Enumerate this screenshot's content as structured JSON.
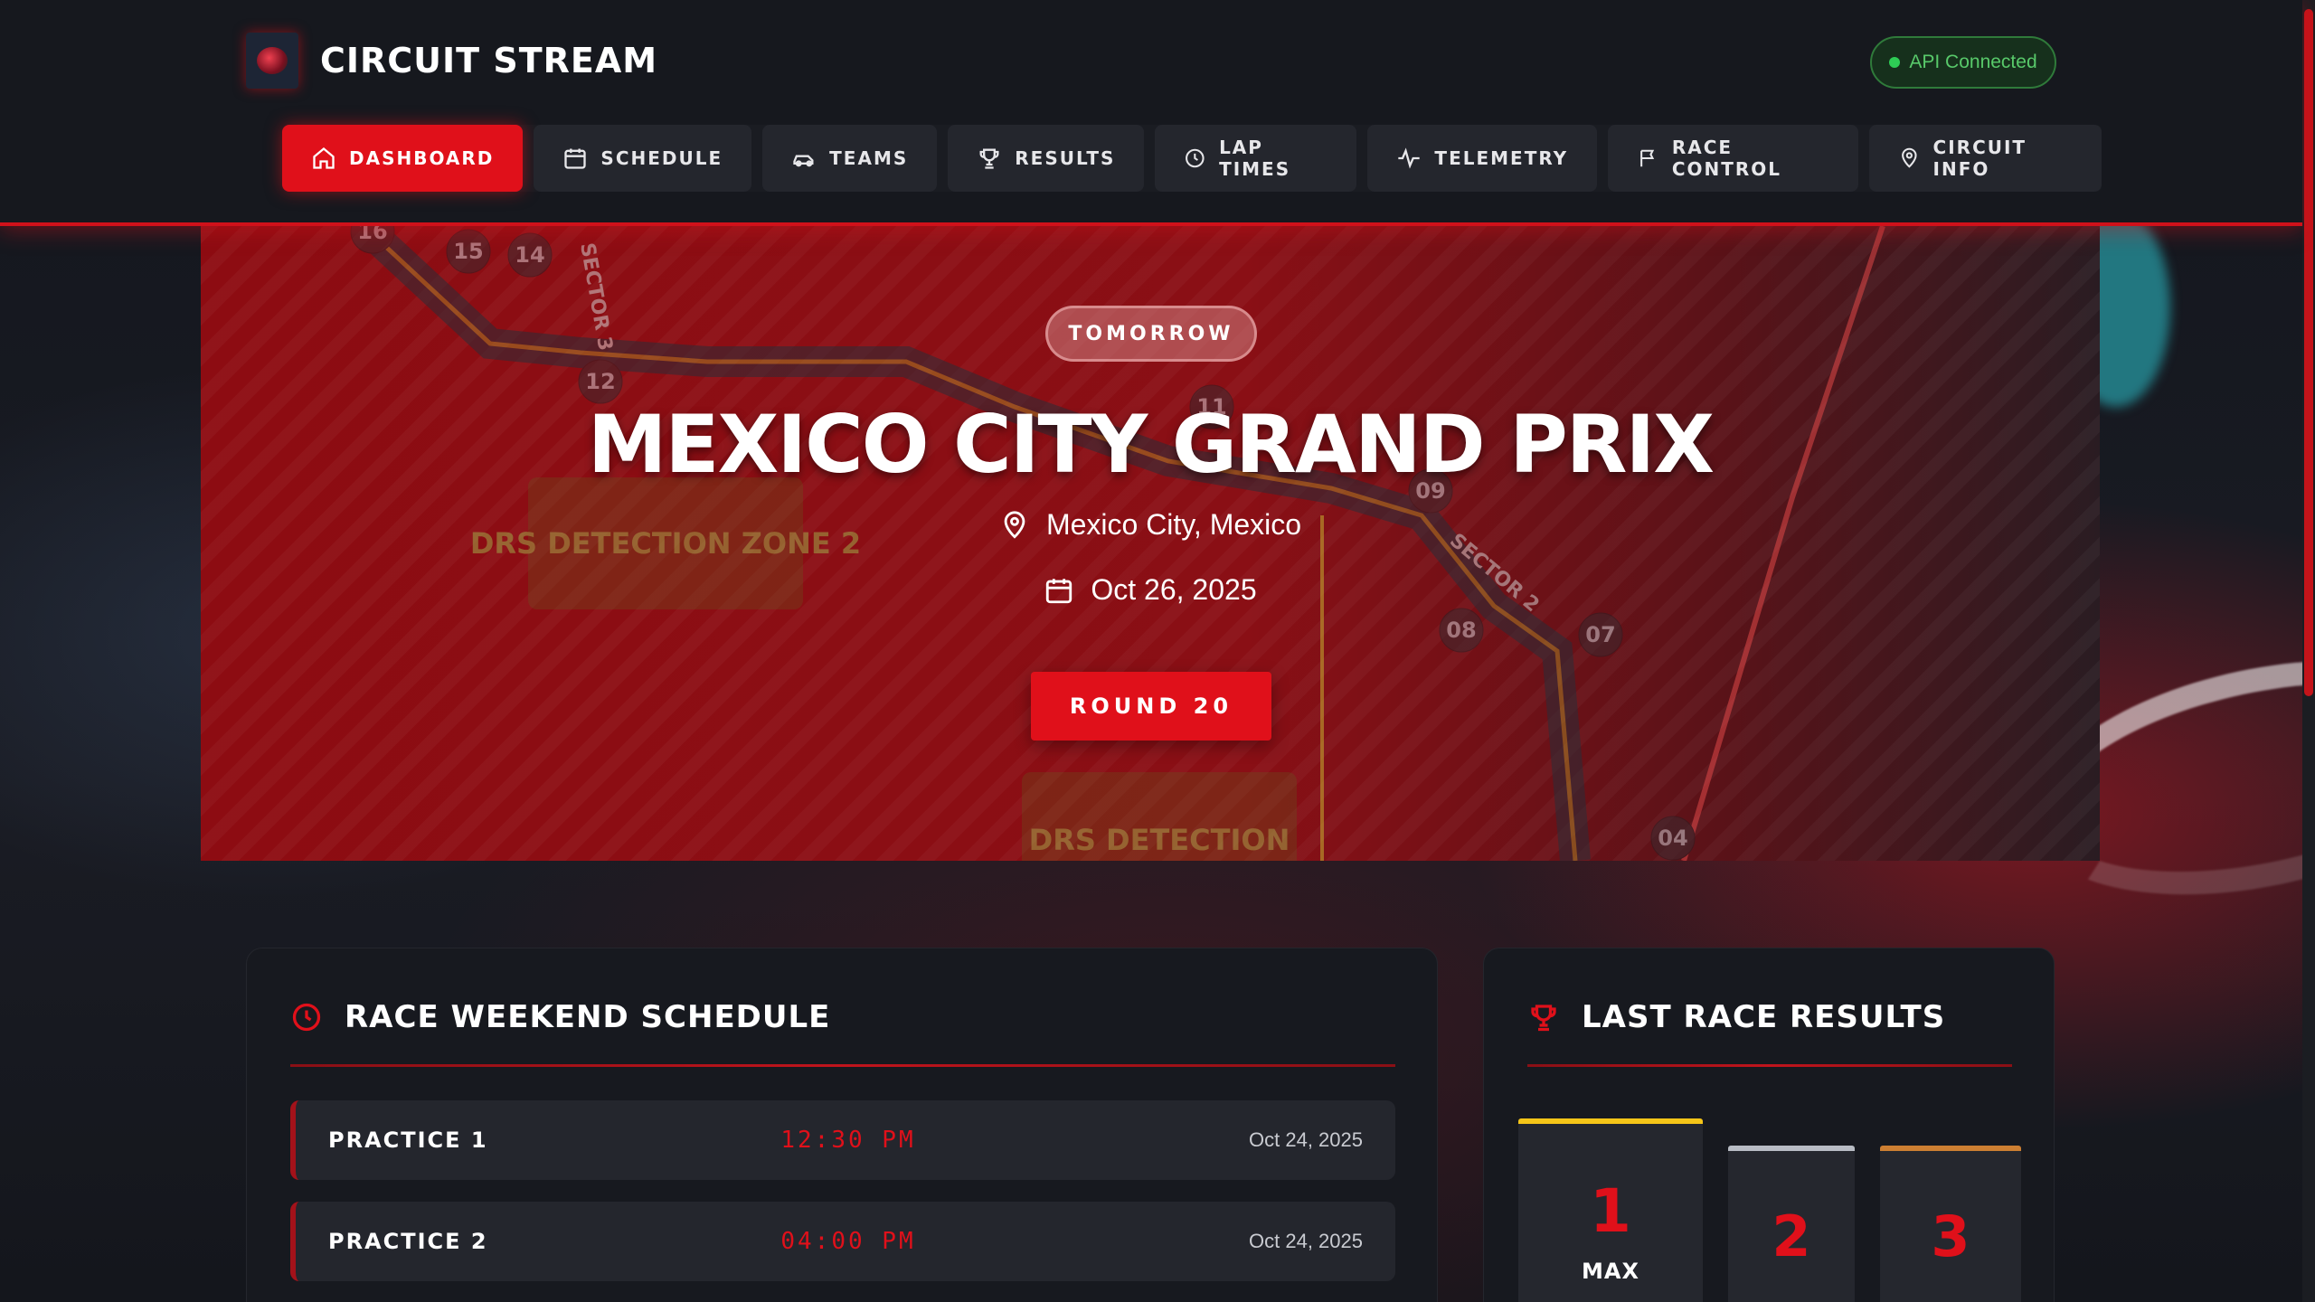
{
  "brand": {
    "name": "CIRCUIT STREAM"
  },
  "api_status": {
    "label": "API Connected",
    "color": "#2ecc55"
  },
  "nav": {
    "items": [
      {
        "label": "DASHBOARD",
        "icon": "home-icon",
        "active": true
      },
      {
        "label": "SCHEDULE",
        "icon": "calendar-icon"
      },
      {
        "label": "TEAMS",
        "icon": "car-icon"
      },
      {
        "label": "RESULTS",
        "icon": "trophy-icon"
      },
      {
        "label": "LAP TIMES",
        "icon": "clock-icon"
      },
      {
        "label": "TELEMETRY",
        "icon": "activity-icon"
      },
      {
        "label": "RACE CONTROL",
        "icon": "flag-icon"
      },
      {
        "label": "CIRCUIT INFO",
        "icon": "map-pin-icon"
      }
    ]
  },
  "hero": {
    "badge": "TOMORROW",
    "title": "MEXICO CITY GRAND PRIX",
    "location": "Mexico City, Mexico",
    "date": "Oct 26, 2025",
    "round_label": "ROUND 20",
    "map_labels": {
      "turns": [
        "16",
        "15",
        "14",
        "12",
        "11",
        "09",
        "08",
        "07",
        "04"
      ],
      "sectors": [
        "SECTOR 3",
        "SECTOR 2"
      ],
      "drs_zone_2": "DRS DETECTION ZONE 2",
      "drs_zone": "DRS DETECTION"
    }
  },
  "schedule": {
    "title": "RACE WEEKEND SCHEDULE",
    "sessions": [
      {
        "name": "PRACTICE 1",
        "time": "12:30 PM",
        "date": "Oct 24, 2025"
      },
      {
        "name": "PRACTICE 2",
        "time": "04:00 PM",
        "date": "Oct 24, 2025"
      }
    ]
  },
  "results": {
    "title": "LAST RACE RESULTS",
    "podium": [
      {
        "position": "1",
        "name": "MAX",
        "color": "#f5c518"
      },
      {
        "position": "2",
        "name": "",
        "color": "#b8bcc4"
      },
      {
        "position": "3",
        "name": "",
        "color": "#cd7f32"
      }
    ]
  },
  "colors": {
    "accent": "#e0101a",
    "background": "#0f1116",
    "panel": "#17191f"
  }
}
